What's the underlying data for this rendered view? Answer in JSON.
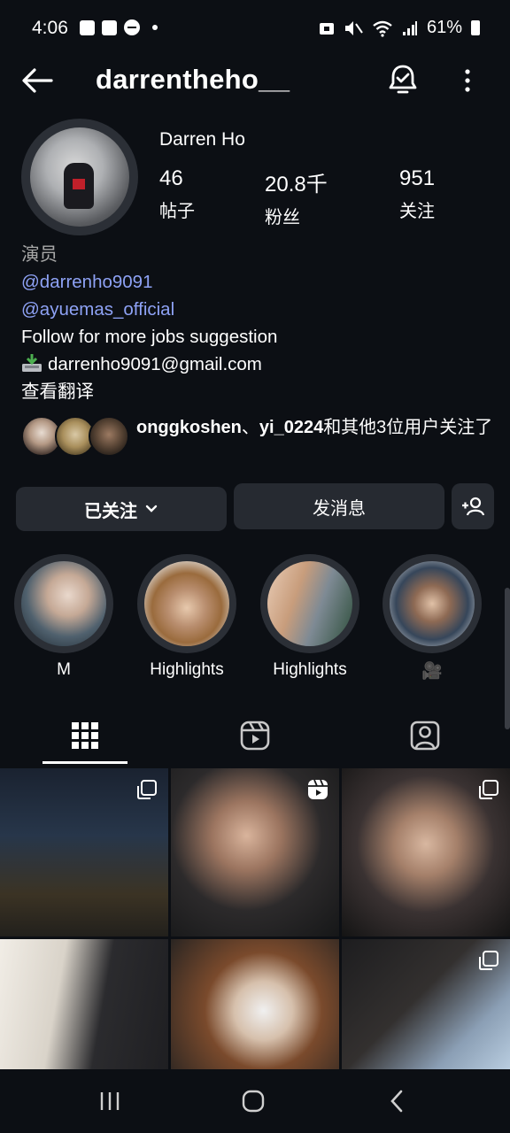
{
  "status": {
    "time": "4:06",
    "battery": "61%"
  },
  "header": {
    "username": "darrentheho__"
  },
  "profile": {
    "display_name": "Darren Ho",
    "stats": [
      {
        "value": "46",
        "label": "帖子"
      },
      {
        "value": "20.8千",
        "label": "粉丝"
      },
      {
        "value": "951",
        "label": "关注"
      }
    ]
  },
  "bio": {
    "category": "演员",
    "mentions": [
      "@darrenho9091",
      "@ayuemas_official"
    ],
    "line": "Follow for more jobs suggestion",
    "email": "darrenho9091@gmail.com",
    "translate": "查看翻译"
  },
  "followed_by": {
    "user1": "onggkoshen",
    "separator": "、",
    "user2": "yi_0224",
    "rest": "和其他3位用户关注了"
  },
  "actions": {
    "following": "已关注",
    "message": "发消息"
  },
  "highlights": [
    {
      "label": "M"
    },
    {
      "label": "Highlights"
    },
    {
      "label": "Highlights"
    },
    {
      "label": "🎥"
    }
  ],
  "tabs": [
    "posts-grid",
    "reels",
    "tagged"
  ],
  "colors": {
    "background": "#0c0f14",
    "button": "#262a31",
    "link": "#8ea2f5"
  },
  "icons": {
    "back": "back-arrow-icon",
    "bell": "notification-bell-icon",
    "more": "more-vertical-icon",
    "add_user": "add-user-icon"
  }
}
